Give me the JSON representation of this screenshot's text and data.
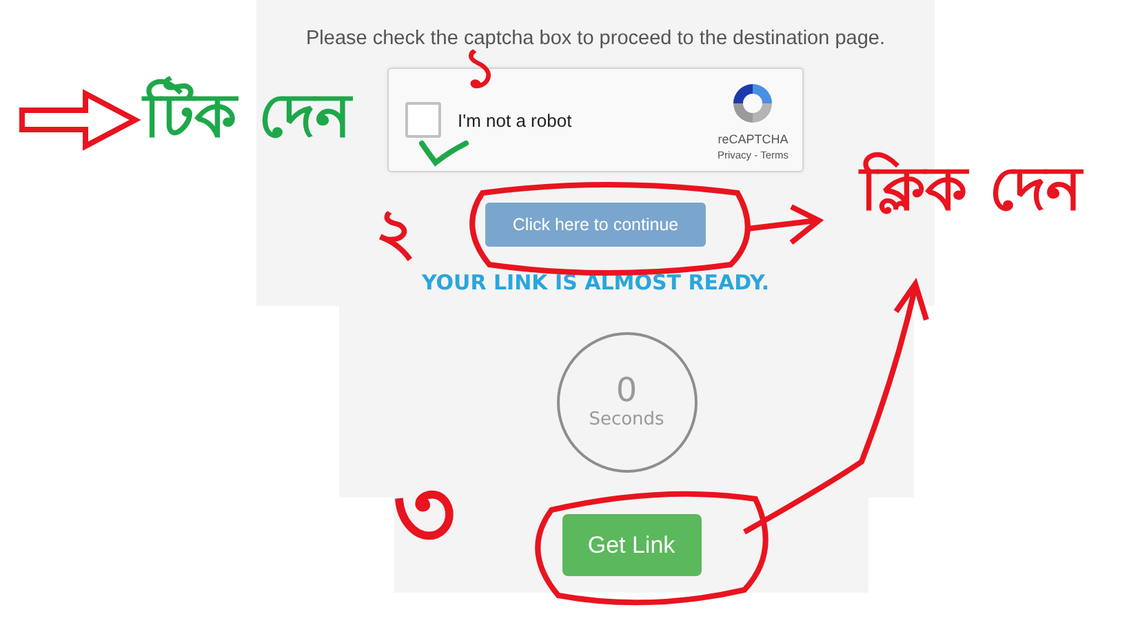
{
  "page": {
    "instruction": "Please check the captcha box to proceed to the destination page.",
    "captcha": {
      "checked": false,
      "label": "I'm not a robot",
      "brand": "reCAPTCHA",
      "links": "Privacy - Terms"
    },
    "continue_button": "Click here to continue",
    "status_heading": "YOUR LINK IS ALMOST READY.",
    "countdown": {
      "value": "0",
      "unit": "Seconds"
    },
    "get_link_button": "Get Link"
  },
  "annotations": {
    "labels": [
      {
        "text": "টিক দেন",
        "color": "#1ea84a"
      },
      {
        "text": "ক্লিক দেন",
        "color": "#e8141f"
      }
    ],
    "numerals": [
      "১",
      "২",
      "৩"
    ]
  }
}
